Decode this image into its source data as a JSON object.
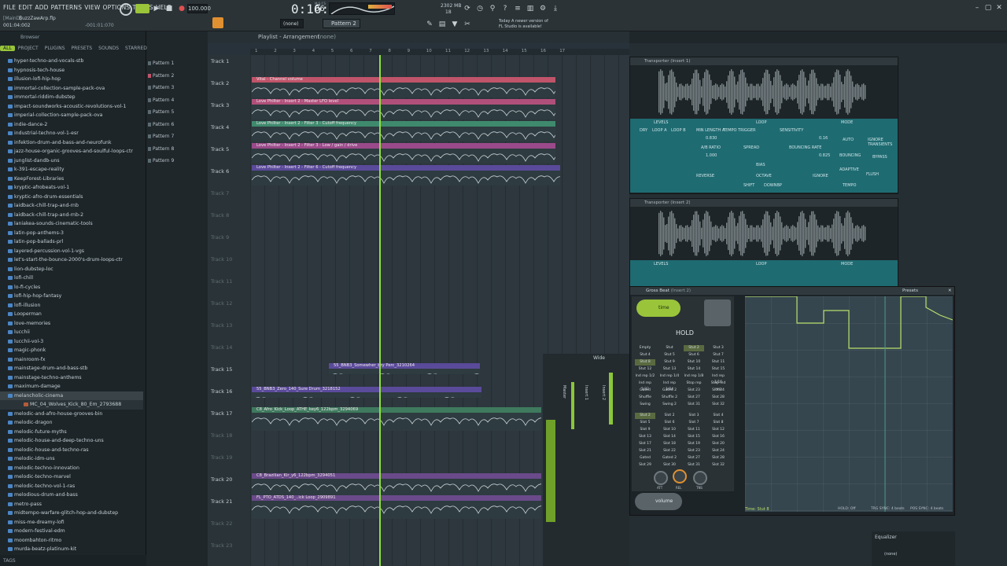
{
  "menu": [
    "FILE",
    "EDIT",
    "ADD",
    "PATTERNS",
    "VIEW",
    "OPTIONS",
    "TOOLS",
    "HELP"
  ],
  "project": {
    "name": "BuzzZawArp.flp",
    "hint": "[MainD]",
    "pos": "001:04:002",
    "pos2": "-001:01:070"
  },
  "tempo": "100.000",
  "time": {
    "main": "0:16:",
    "sub": "06",
    "unit": "M:S:CS"
  },
  "cpu": {
    "mem": "2302 MB",
    "val": "18"
  },
  "news": {
    "line1": "Today  A newer version of",
    "line2": "FL Studio is available!"
  },
  "pattern_sel": "Pattern 2",
  "snap": "(none)",
  "playlist": {
    "title": "Playlist - Arrangement",
    "crumb": "(none)"
  },
  "browser": {
    "label": "Browser",
    "tabs": [
      "ALL",
      "PROJECT",
      "PLUGINS",
      "PRESETS",
      "SOUNDS",
      "STARRED"
    ],
    "items": [
      "hyper-techno-and-vocals-stb",
      "hypnosis-tech-house",
      "illusion-lofi-hip-hop",
      "immortal-collection-sample-pack-ova",
      "immortal-riddim-dubstep",
      "impact-soundworks-acoustic-revolutions-vol-1",
      "imperial-collection-sample-pack-ova",
      "indie-dance-2",
      "industrial-techno-vol-1-esr",
      "infektion-drum-and-bass-and-neurofunk",
      "jazz-house-organic-grooves-and-soulful-loops-ctr",
      "junglist-dandb-uns",
      "k-391-escape-reality",
      "KeepForest-Libraries",
      "kryptic-afrobeats-vol-1",
      "kryptic-afro-drum-essentials",
      "laidback-chill-trap-and-rnb",
      "laidback-chill-trap-and-rnb-2",
      "laniakea-sounds-cinematic-tools",
      "latin-pop-anthems-3",
      "latin-pop-ballads-prl",
      "layered-percussion-vol-1-vgs",
      "let's-start-the-bounce-2000's-drum-loops-ctr",
      "lion-dubstep-loc",
      "lofi-chill",
      "lo-fi-cycles",
      "lofi-hip-hop-fantasy",
      "lofi-illusion",
      "Looperman",
      "love-memories",
      "lucchii",
      "lucchii-vol-3",
      "magic-phonk",
      "mainroom-fx",
      "mainstage-drum-and-bass-stb",
      "mainstage-techno-anthems",
      "maximum-damage",
      "melancholic-cinema",
      "MC_04_Wolves_Kick_80_Em_2793688",
      "melodic-and-afro-house-grooves-bin",
      "melodic-dragon",
      "melodic-future-myths",
      "melodic-house-and-deep-techno-uns",
      "melodic-house-and-techno-ras",
      "melodic-idm-uns",
      "melodic-techno-innovation",
      "melodic-techno-marvel",
      "melodic-techno-vol-1-ras",
      "melodious-drum-and-bass",
      "metro-pass",
      "midtempo-warfare-glitch-hop-and-dubstep",
      "miss-me-dreamy-lofi",
      "modern-festival-edm",
      "moombahton-ritmo",
      "murda-beatz-platinum-kit"
    ],
    "tags": "TAGS"
  },
  "patterns": [
    "Pattern 1",
    "Pattern 2",
    "Pattern 3",
    "Pattern 4",
    "Pattern 5",
    "Pattern 6",
    "Pattern 7",
    "Pattern 8",
    "Pattern 9"
  ],
  "ruler": [
    "1",
    "2",
    "3",
    "4",
    "5",
    "6",
    "7",
    "8",
    "9",
    "10",
    "11",
    "12",
    "13",
    "14",
    "15",
    "16",
    "17"
  ],
  "ruler_markers": [
    "Pattern 1",
    "Pattern 4",
    "Pattern 1",
    "Pattern 3",
    "Pattern 2"
  ],
  "tracks": [
    "Track 1",
    "Track 2",
    "Track 3",
    "Track 4",
    "Track 5",
    "Track 6",
    "Track 7",
    "Track 8",
    "Track 9",
    "Track 10",
    "Track 11",
    "Track 12",
    "Track 13",
    "Track 14",
    "Track 15",
    "Track 16",
    "Track 17",
    "Track 18",
    "Track 19",
    "Track 20",
    "Track 21",
    "Track 22",
    "Track 23"
  ],
  "clips": {
    "t2": "Vital - Channel volume",
    "t3": "Love Philter - Insert 2 - Master LFO level",
    "t4": "Love Philter - Insert 2 - Filter 3 - Cutoff frequency",
    "t5": "Love Philter - Insert 2 - Filter 3 - Low / gain / drive",
    "t6": "Love Philter - Insert 2 - Filter 6 - Cutoff frequency",
    "t15": "55_BNB3_Somewher_bry Perc_3210264",
    "t16": "55_BNB3_Zero_140_Sure Drum_3218152",
    "t17": "C8_Afro_Kick_Loop_ATHE_key6_122bpm_3294069",
    "t20": "C8_Brazilian_Kir_y6_122bpm_3294051",
    "t21": "FL_PTO_ATDS_140_..ick Loop_2909891"
  },
  "transporter1": {
    "title": "Transporter (Insert 1)",
    "presets": "Presets"
  },
  "transporter2": {
    "title": "Transporter (Insert 2)",
    "presets": "Presets"
  },
  "tp_labels": {
    "levels": "LEVELS",
    "loop": "LOOP",
    "mode": "MODE",
    "dry": "DRY",
    "loopa": "LOOP A",
    "loopb": "LOOP B",
    "minlen": "MIN LENGTH A",
    "tempotrig": "TEMPO TRIGGER",
    "sens": "SENSITIVITY",
    "airratio": "A/B RATIO",
    "spread": "SPREAD",
    "bounce": "BOUNCING RATE",
    "bias": "BIAS",
    "reverse": "REVERSE",
    "octave": "OCTAVE",
    "downbp": "DOWNBP",
    "shift": "SHIFT",
    "ignore": "IGNORE",
    "auto": "AUTO",
    "bouncing": "BOUNCING",
    "adaptive": "ADAPTIVE",
    "tempo": "TEMPO",
    "ignoretrans": "IGNORE TRANSIENTS",
    "bypass": "BYPASS",
    "flush": "FLUSH",
    "v1": "0.830",
    "v2": "1.000",
    "v3": "0.16",
    "v4": "0.825"
  },
  "gross": {
    "title": "Gross Beat",
    "insert": "(Insert 2)",
    "presets": "Presets",
    "time": "time",
    "hold": "HOLD",
    "volume": "volume",
    "slots": [
      "Empty",
      "Stut",
      "Stut 2",
      "Stut 3",
      "Stut 4",
      "Stut 5",
      "Stut 6",
      "Stut 7",
      "Stut 8",
      "Stut 9",
      "Stut 10",
      "Stut 11",
      "Stut 12",
      "Stut 13",
      "Stut 14",
      "Stut 15",
      "Ind rep 1/2",
      "Ind rep 1/4",
      "Ind rep 1/8",
      "Ind rep 1/16",
      "Ind rep 1/32",
      "Ind rep 1/64",
      "Stop rep",
      "Stop ind rep",
      "Gated",
      "Gated 2",
      "Slot 23",
      "Slot 24",
      "Shuffle",
      "Shuffle 2",
      "Slot 27",
      "Slot 28",
      "Swing",
      "Swing 2",
      "Slot 31",
      "Slot 32"
    ],
    "slots2": [
      "Stut 2",
      "Slot 2",
      "Slot 3",
      "Slot 4",
      "Slot 5",
      "Slot 6",
      "Slot 7",
      "Slot 8",
      "Slot 9",
      "Slot 10",
      "Slot 11",
      "Slot 12",
      "Slot 13",
      "Slot 14",
      "Slot 15",
      "Slot 16",
      "Slot 17",
      "Slot 18",
      "Slot 19",
      "Slot 20",
      "Slot 21",
      "Slot 22",
      "Slot 23",
      "Slot 24",
      "Gated",
      "Gated 2",
      "Slot 27",
      "Slot 28",
      "Slot 29",
      "Slot 30",
      "Slot 31",
      "Slot 32"
    ],
    "knobs": [
      "ATT",
      "REL",
      "TNS"
    ],
    "footer": "Time: Stut 8",
    "hold_opt": "HOLD: Off",
    "trg": "TRG SYNC: 4 beats",
    "pos": "POS SYNC: 4 beats"
  },
  "mixer": {
    "wide": "Wide",
    "ch": [
      "Master",
      "Insert 1",
      "Insert 2"
    ]
  },
  "equalizer": "Equalizer",
  "slot_none": "(none)"
}
